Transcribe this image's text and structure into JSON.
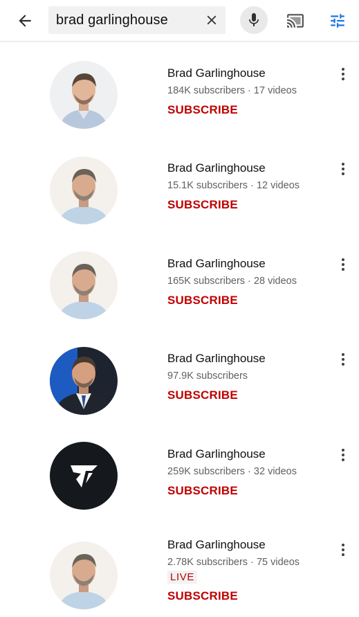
{
  "search": {
    "query": "brad garlinghouse"
  },
  "icons": {
    "back": "arrow-back-icon",
    "clear": "close-icon",
    "mic": "microphone-icon",
    "cast": "cast-icon",
    "filter": "filter-sliders-icon",
    "more": "more-vertical-icon"
  },
  "colors": {
    "subscribe": "#c00000",
    "filter_accent": "#1a73e8",
    "meta_text": "#606060"
  },
  "results": [
    {
      "name": "Brad Garlinghouse",
      "meta": "184K subscribers · 17 videos",
      "subscribe": "SUBSCRIBE",
      "avatar": "portrait-light"
    },
    {
      "name": "Brad Garlinghouse",
      "meta": "15.1K subscribers · 12 videos",
      "subscribe": "SUBSCRIBE",
      "avatar": "portrait"
    },
    {
      "name": "Brad Garlinghouse",
      "meta": "165K subscribers · 28 videos",
      "subscribe": "SUBSCRIBE",
      "avatar": "portrait"
    },
    {
      "name": "Brad Garlinghouse",
      "meta": "97.9K subscribers",
      "subscribe": "SUBSCRIBE",
      "avatar": "portrait-suit"
    },
    {
      "name": "Brad Garlinghouse",
      "meta": "259K subscribers · 32 videos",
      "subscribe": "SUBSCRIBE",
      "avatar": "logo-dark"
    },
    {
      "name": "Brad Garlinghouse",
      "meta": "2.78K subscribers · 75 videos",
      "live": "LIVE",
      "subscribe": "SUBSCRIBE",
      "avatar": "portrait"
    }
  ]
}
